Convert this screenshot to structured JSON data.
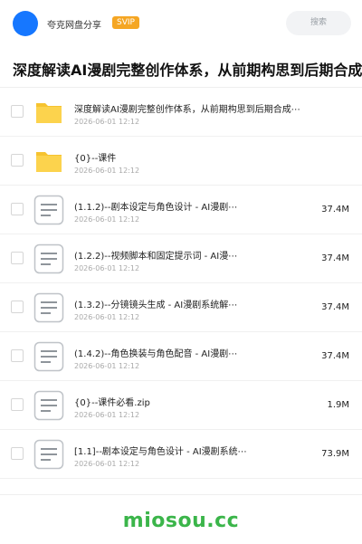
{
  "header": {
    "app_name": "夸克网盘分享",
    "badge": "SVIP",
    "search_placeholder": "搜索",
    "colors": {
      "avatar": "#1677ff",
      "badge": "#f5a623"
    }
  },
  "page_title": "深度解读AI漫剧完整创作体系，从前期构思到后期合成一站",
  "files": [
    {
      "type": "folder",
      "name": "深度解读AI漫剧完整创作体系，从前期构思到后期合成⋯",
      "date": "2026-06-01 12:12",
      "size": ""
    },
    {
      "type": "folder",
      "name": "{0}--课件",
      "date": "2026-06-01 12:12",
      "size": ""
    },
    {
      "type": "file",
      "name": "(1.1.2)--剧本设定与角色设计 - AI漫剧⋯",
      "date": "2026-06-01 12:12",
      "size": "37.4M"
    },
    {
      "type": "file",
      "name": "(1.2.2)--视频脚本和固定提示词 - AI漫⋯",
      "date": "2026-06-01 12:12",
      "size": "37.4M"
    },
    {
      "type": "file",
      "name": "(1.3.2)--分镜镜头生成 - AI漫剧系统解⋯",
      "date": "2026-06-01 12:12",
      "size": "37.4M"
    },
    {
      "type": "file",
      "name": "(1.4.2)--角色换装与角色配音 - AI漫剧⋯",
      "date": "2026-06-01 12:12",
      "size": "37.4M"
    },
    {
      "type": "file",
      "name": "{0}--课件必看.zip",
      "date": "2026-06-01 12:12",
      "size": "1.9M"
    },
    {
      "type": "file",
      "name": "[1.1]--剧本设定与角色设计 - AI漫剧系统⋯",
      "date": "2026-06-01 12:12",
      "size": "73.9M"
    }
  ],
  "icons": {
    "folder": "folder-icon",
    "file": "document-icon"
  },
  "watermark": "miosou.cc"
}
